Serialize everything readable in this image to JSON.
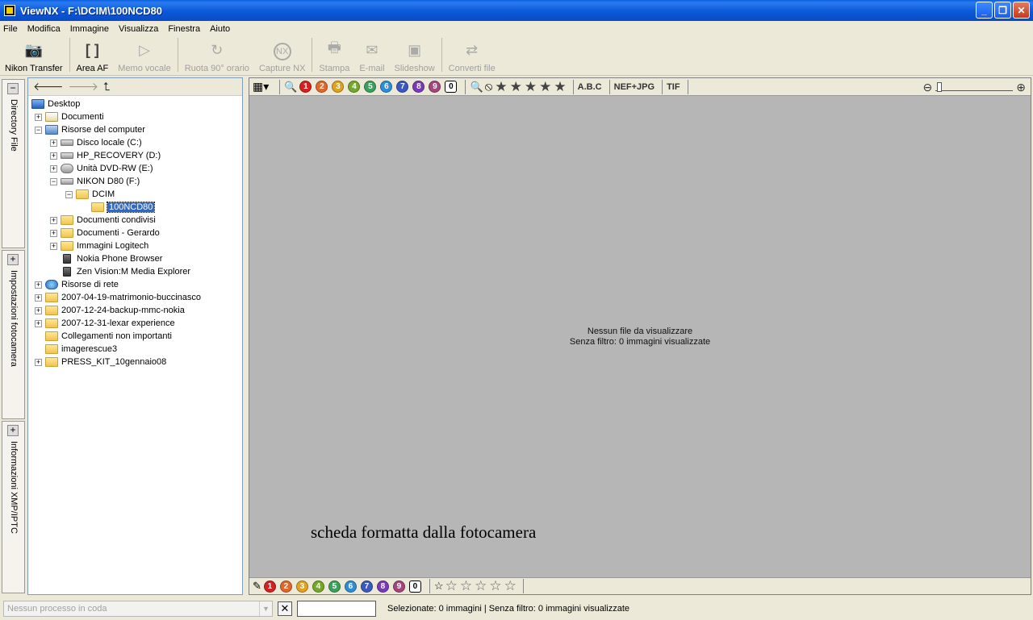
{
  "window": {
    "title": "ViewNX - F:\\DCIM\\100NCD80"
  },
  "menu": [
    "File",
    "Modifica",
    "Immagine",
    "Visualizza",
    "Finestra",
    "Aiuto"
  ],
  "toolbar": {
    "nikon_transfer": "Nikon Transfer",
    "area_af": "Area AF",
    "memo_vocale": "Memo vocale",
    "ruota": "Ruota 90° orario",
    "capture_nx": "Capture NX",
    "stampa": "Stampa",
    "email": "E-mail",
    "slideshow": "Slideshow",
    "converti": "Converti file"
  },
  "side_tabs": {
    "directory": "Directory File",
    "impostazioni": "Impostazioni fotocamera",
    "informazioni": "Informazioni XMP/IPTC"
  },
  "tree": [
    "Desktop",
    "Documenti",
    "Risorse del computer",
    "Disco locale (C:)",
    "HP_RECOVERY (D:)",
    "Unità DVD-RW (E:)",
    "NIKON D80 (F:)",
    "DCIM",
    "100NCD80",
    "Documenti condivisi",
    "Documenti - Gerardo",
    "Immagini Logitech",
    "Nokia Phone Browser",
    "Zen Vision:M Media Explorer",
    "Risorse di rete",
    "2007-04-19-matrimonio-buccinasco",
    "2007-12-24-backup-mmc-nokia",
    "2007-12-31-lexar experience",
    "Collegamenti non importanti",
    "imagerescue3",
    "PRESS_KIT_10gennaio08"
  ],
  "viewer": {
    "labels": [
      "1",
      "2",
      "3",
      "4",
      "5",
      "6",
      "7",
      "8",
      "9",
      "0"
    ],
    "label_colors": [
      "#d32020",
      "#e2662a",
      "#e0a31f",
      "#74a82b",
      "#3aa05c",
      "#2d8ed6",
      "#3a58c2",
      "#7a3ab8",
      "#a3467e",
      "#d278b8"
    ],
    "sort_text": "A.B.C",
    "filter_nef": "NEF+JPG",
    "filter_tif": "TIF",
    "empty_line1": "Nessun file da visualizzare",
    "empty_line2": "Senza filtro: 0 immagini visualizzate",
    "caption": "scheda formatta dalla fotocamera"
  },
  "status": {
    "queue_placeholder": "Nessun processo in coda",
    "text": "Selezionate: 0 immagini | Senza filtro: 0 immagini visualizzate"
  }
}
